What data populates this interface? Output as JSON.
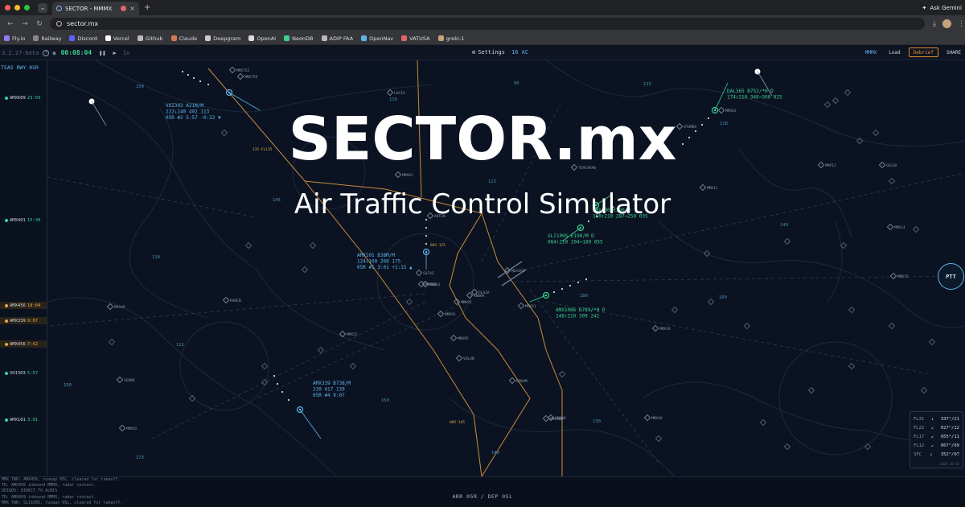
{
  "browser": {
    "tab_title": "SECTOR - MMMX",
    "url": "sector.mx",
    "ask_label": "Ask Gemini",
    "bookmarks": [
      "Fly.io",
      "Railway",
      "Discord",
      "Vercel",
      "Github",
      "Claude",
      "Deepgram",
      "OpenAI",
      "NeonDB",
      "ADIP FAA",
      "OpenNav",
      "VATUSA",
      "greki-1"
    ],
    "bookmark_colors": [
      "#8e7cf0",
      "#888888",
      "#5865f2",
      "#ffffff",
      "#bbbbbb",
      "#d97757",
      "#cccccc",
      "#dddddd",
      "#39d28f",
      "#bbbbbb",
      "#5fb3e8",
      "#e06666",
      "#c8a27a"
    ]
  },
  "toolbar": {
    "version": "3.2.27-beta",
    "clock": "00:08:04",
    "speed": "1x",
    "settings_label": "Settings",
    "ac_count": "16 AC",
    "airport": "MMMX",
    "load_label": "Load",
    "debrief_label": "Debrief",
    "share_label": "SHARE"
  },
  "hero": {
    "title": "SECTOR.mx",
    "subtitle": "Air Traffic Control Simulator"
  },
  "strips": {
    "header": "TSAS RWY 05R",
    "items": [
      {
        "callsign": "AMX609",
        "time": "23:03",
        "kind": "arr",
        "color": "#39d28f"
      },
      {
        "callsign": "AMX401",
        "time": "15:30",
        "kind": "arr",
        "color": "#39d28f"
      },
      {
        "callsign": "AMX456",
        "time": "18:04",
        "kind": "dep",
        "color": "#e0a84a"
      },
      {
        "callsign": "AMX339",
        "time": "9:07",
        "kind": "dep",
        "color": "#e0a84a"
      },
      {
        "callsign": "AMX456",
        "time": "7:42",
        "kind": "dep",
        "color": "#e0a84a"
      },
      {
        "callsign": "VOI303",
        "time": "5:57",
        "kind": "arr",
        "color": "#39d28f"
      },
      {
        "callsign": "AMX101",
        "time": "3:01",
        "kind": "arr",
        "color": "#39d28f"
      }
    ]
  },
  "scope": {
    "fixes": [
      "LUCIA",
      "OTUMBA",
      "MMX03",
      "TEPEXPAN",
      "MMX11",
      "MMX12",
      "GELOX",
      "MMX14",
      "MMX15",
      "MMX01",
      "AKTEN",
      "SUTAS",
      "MEXICO",
      "PLAZA",
      "MMX92",
      "MMX91",
      "MMX95",
      "VOLUN",
      "EPKUM",
      "MMX39",
      "SERNO",
      "MMX40",
      "MMX65",
      "MMX52",
      "RAKEN",
      "MASAP",
      "ANDRA",
      "MMX51",
      "MMX40B",
      "MMX60",
      "SRNDK",
      "MMX63",
      "MMX752",
      "MMX759"
    ],
    "altitudes": [
      "150",
      "145",
      "110",
      "112",
      "150",
      "150",
      "90",
      "115",
      "110",
      "113",
      "140",
      "160",
      "180",
      "130",
      "140",
      "173",
      "118"
    ],
    "restrictions": [
      "135-FL135",
      "085-125",
      "085-145"
    ],
    "aircraft": [
      {
        "line1": "VOI303 A21N/M",
        "line2": "222↓140 402 113",
        "line3": "05R #2 5:57 -0:22 ▼",
        "color": "#5fb3e8"
      },
      {
        "line1": "DAL365 B752/*H D",
        "line2": "174↓210 346→300 025",
        "line3": "",
        "color": "#39d28f"
      },
      {
        "line1": "AMX101 B38M/M",
        "line2": "124↓100 268 175",
        "line3": "05R #1 3:01 +1:15 ▲",
        "color": "#5fb3e8"
      },
      {
        "line1": "SLI1095 E190/M D",
        "line2": "084↑210 204→180 055",
        "line3": "",
        "color": "#39d28f"
      },
      {
        "line1": "AMX1086 B789/*H D",
        "line2": "148↑210 309 242",
        "line3": "",
        "color": "#39d28f"
      },
      {
        "line1": "AMX339 B738/M",
        "line2": "230 417 139",
        "line3": "05R #4 9:07",
        "color": "#5fb3e8"
      },
      {
        "line1": "AMX400 E190/M",
        "line2": "160↑210 287→250 035",
        "line3": "",
        "color": "#39d28f"
      }
    ],
    "ptt_label": "PTT"
  },
  "winds": {
    "rows": [
      {
        "level": "FL31",
        "arrow": "↓",
        "value": "337°/21"
      },
      {
        "level": "FL22",
        "arrow": "↙",
        "value": "027°/12"
      },
      {
        "level": "FL17",
        "arrow": "↙",
        "value": "055°/11"
      },
      {
        "level": "FL12",
        "arrow": "↙",
        "value": "067°/09"
      },
      {
        "level": "SFC",
        "arrow": "↓",
        "value": "352°/07"
      }
    ],
    "date": "2025-10-15"
  },
  "bottom": {
    "log": [
      "MMX TWR: AMX456, runway 05L, cleared for takeoff.",
      "TR: AMX456 inbound MMMX, radar contact.",
      "DEI805: DIRECT_TO ALMIS",
      "TR: AMX609 inbound MMMX, radar contact.",
      "MMX TWR: SLI1095, runway 05L, cleared for takeoff."
    ],
    "runway_config": "ARR 05R / DEP 05L"
  },
  "colors": {
    "accent": "#5fb3e8",
    "arrival": "#39d28f",
    "departure": "#e0a84a",
    "boundary": "#c98a3a"
  }
}
